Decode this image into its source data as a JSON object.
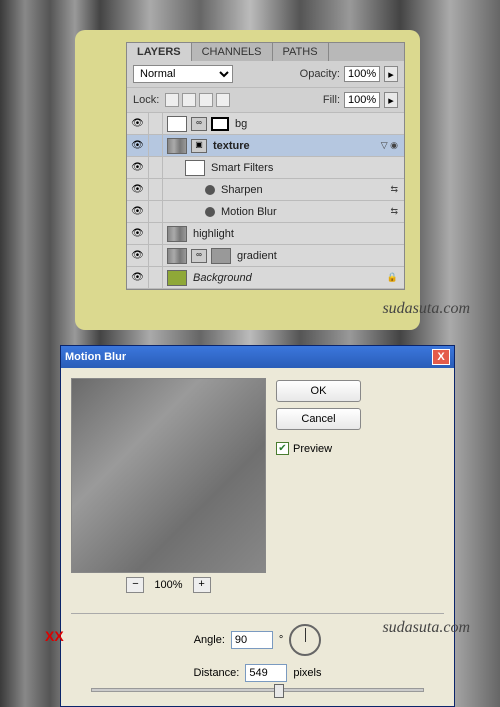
{
  "layers_panel": {
    "tabs": [
      "LAYERS",
      "CHANNELS",
      "PATHS"
    ],
    "blend_mode": "Normal",
    "opacity_label": "Opacity:",
    "opacity_value": "100%",
    "lock_label": "Lock:",
    "fill_label": "Fill:",
    "fill_value": "100%",
    "layers": [
      {
        "name": "bg"
      },
      {
        "name": "texture"
      },
      {
        "name": "Smart Filters"
      },
      {
        "name": "Sharpen"
      },
      {
        "name": "Motion Blur"
      },
      {
        "name": "highlight"
      },
      {
        "name": "gradient"
      },
      {
        "name": "Background"
      }
    ]
  },
  "watermark": "sudasuta.com",
  "xx_label": "XX",
  "dialog": {
    "title": "Motion Blur",
    "ok": "OK",
    "cancel": "Cancel",
    "preview_label": "Preview",
    "zoom_minus": "−",
    "zoom_value": "100%",
    "zoom_plus": "+",
    "angle_label": "Angle:",
    "angle_value": "90",
    "angle_unit": "°",
    "distance_label": "Distance:",
    "distance_value": "549",
    "distance_unit": "pixels"
  }
}
